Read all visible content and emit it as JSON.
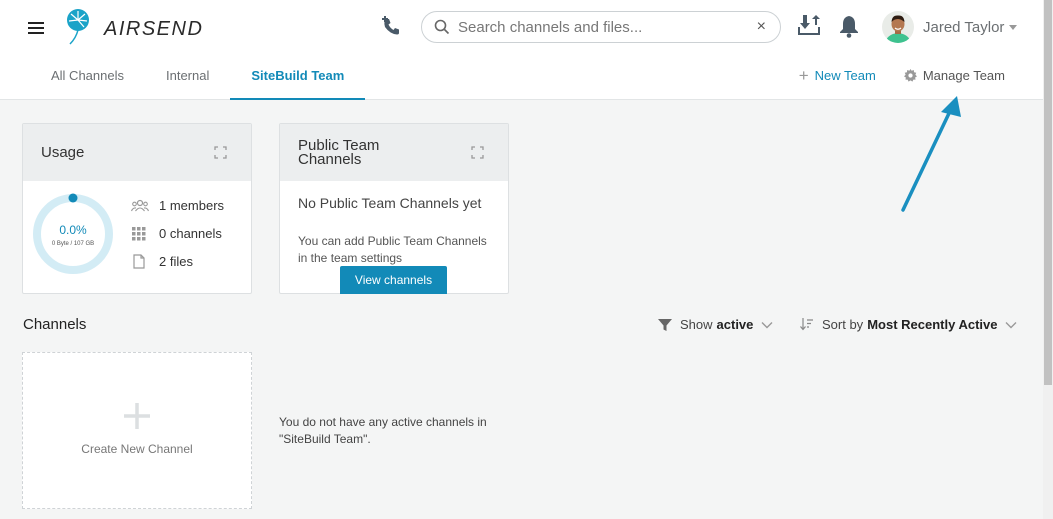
{
  "app": {
    "logo_text": "AIRSEND"
  },
  "search": {
    "placeholder": "Search channels and files...",
    "clear": "×"
  },
  "user": {
    "name": "Jared Taylor"
  },
  "tabs": [
    {
      "label": "All Channels"
    },
    {
      "label": "Internal"
    },
    {
      "label": "SiteBuild Team",
      "active": true
    }
  ],
  "actions": {
    "new_team": "New Team",
    "manage_team": "Manage Team"
  },
  "usage": {
    "title": "Usage",
    "percent": "0.0%",
    "storage": "0 Byte / 107 GB",
    "members": "1 members",
    "channels": "0 channels",
    "files": "2 files"
  },
  "public_channels": {
    "title": "Public Team Channels",
    "empty_title": "No Public Team Channels yet",
    "empty_sub": "You can add Public Team Channels in the team settings",
    "button": "View channels"
  },
  "channels": {
    "title": "Channels",
    "filter_prefix": "Show",
    "filter_value": "active",
    "sort_prefix": "Sort by",
    "sort_value": "Most Recently Active",
    "create_label": "Create New Channel",
    "empty_message": "You do not have any active channels in \"SiteBuild Team\"."
  },
  "colors": {
    "accent": "#128ab8",
    "annotation_arrow": "#1a8fc0"
  }
}
